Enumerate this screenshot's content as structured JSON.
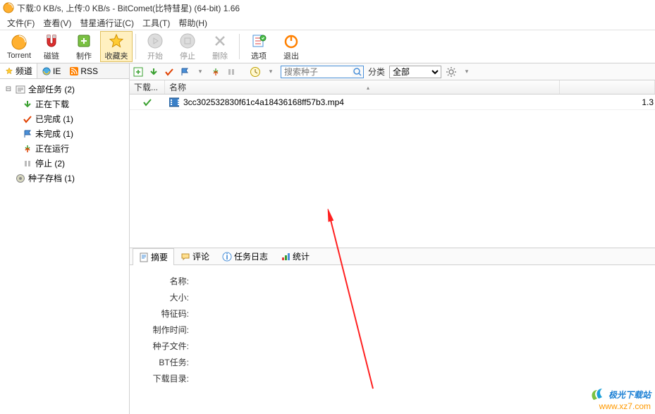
{
  "title": "下载:0 KB/s, 上传:0 KB/s - BitComet(比特彗星) (64-bit) 1.66",
  "menu": {
    "file": "文件(F)",
    "view": "查看(V)",
    "passport": "彗星通行证(C)",
    "tools": "工具(T)",
    "help": "帮助(H)"
  },
  "toolbar": {
    "torrent": "Torrent",
    "magnet": "磁链",
    "make": "制作",
    "favorites": "收藏夹",
    "start": "开始",
    "stop": "停止",
    "delete": "删除",
    "options": "选项",
    "exit": "退出"
  },
  "sidebar": {
    "tabs": {
      "channels": "频道",
      "ie": "IE",
      "rss": "RSS"
    },
    "tree": {
      "all_tasks": "全部任务 (2)",
      "downloading": "正在下载",
      "completed": "已完成 (1)",
      "incomplete": "未完成 (1)",
      "running": "正在运行",
      "stopped": "停止 (2)",
      "seed_archive": "种子存档 (1)"
    }
  },
  "sectoolbar": {
    "search_placeholder": "搜索种子",
    "category_label": "分类",
    "category_value": "全部"
  },
  "columns": {
    "status": "下载...",
    "name": "名称"
  },
  "task": {
    "name": "3cc302532830f61c4a18436168ff57b3.mp4",
    "size_hint": "1.3"
  },
  "bottom_tabs": {
    "summary": "摘要",
    "comments": "评论",
    "tasklog": "任务日志",
    "stats": "统计"
  },
  "summary_labels": {
    "name": "名称:",
    "size": "大小:",
    "hash": "特征码:",
    "created": "制作时间:",
    "torrent_file": "种子文件:",
    "bt_task": "BT任务:",
    "dl_dir": "下载目录:"
  },
  "watermark": {
    "line1": "极光下载站",
    "line2": "www.xz7.com"
  }
}
